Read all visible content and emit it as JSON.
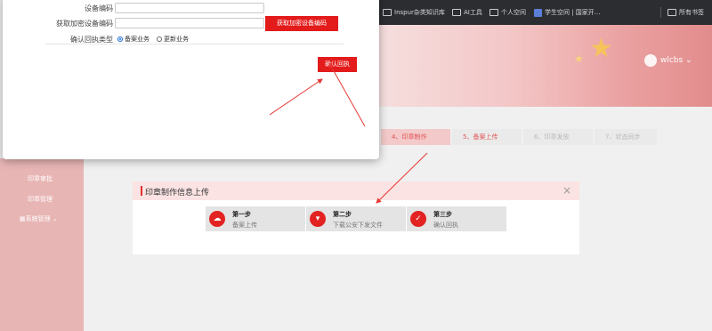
{
  "bookmarks": [
    {
      "label": "Inspur杂类知识库",
      "icon": "folder-icon"
    },
    {
      "label": "AI工具",
      "icon": "folder-icon"
    },
    {
      "label": "个人空间",
      "icon": "folder-icon"
    },
    {
      "label": "学生空间 | 国家开...",
      "icon": "site-icon"
    },
    {
      "label": "所有书签",
      "icon": "folder-icon"
    }
  ],
  "header": {
    "username": "wlcbs"
  },
  "sidebar": {
    "items": [
      {
        "label": "印章审批"
      },
      {
        "label": "印章管理"
      },
      {
        "label": "系统管理"
      }
    ]
  },
  "progress": {
    "steps": [
      {
        "label": "4、印章制作",
        "state": "active"
      },
      {
        "label": "5、备案上传",
        "state": "next"
      },
      {
        "label": "6、印章发放",
        "state": "gray"
      },
      {
        "label": "7、状态同步",
        "state": "gray"
      }
    ]
  },
  "panel": {
    "title": "印章制作信息上传",
    "close": "×",
    "cards": [
      {
        "title": "第一步",
        "subtitle": "备案上传",
        "icon": "upload-cloud-icon"
      },
      {
        "title": "第二步",
        "subtitle": "下载公安下发文件",
        "icon": "folder-download-icon"
      },
      {
        "title": "第三步",
        "subtitle": "确认回执",
        "icon": "check-circle-icon"
      }
    ]
  },
  "modal": {
    "device_code_label": "设备编码",
    "device_code_value": "",
    "encrypted_code_label": "获取加密设备编码",
    "encrypted_code_value": "",
    "get_encrypted_button": "获取加密设备编码",
    "receipt_type_label": "确认回执类型",
    "radio_options": [
      {
        "label": "备案业务",
        "checked": true
      },
      {
        "label": "更新业务",
        "checked": false
      }
    ],
    "confirm_button": "确认回执"
  },
  "colors": {
    "accent": "#e31b1b",
    "panel_header": "#fbe3e3",
    "sidebar": "#e8b5b5"
  }
}
